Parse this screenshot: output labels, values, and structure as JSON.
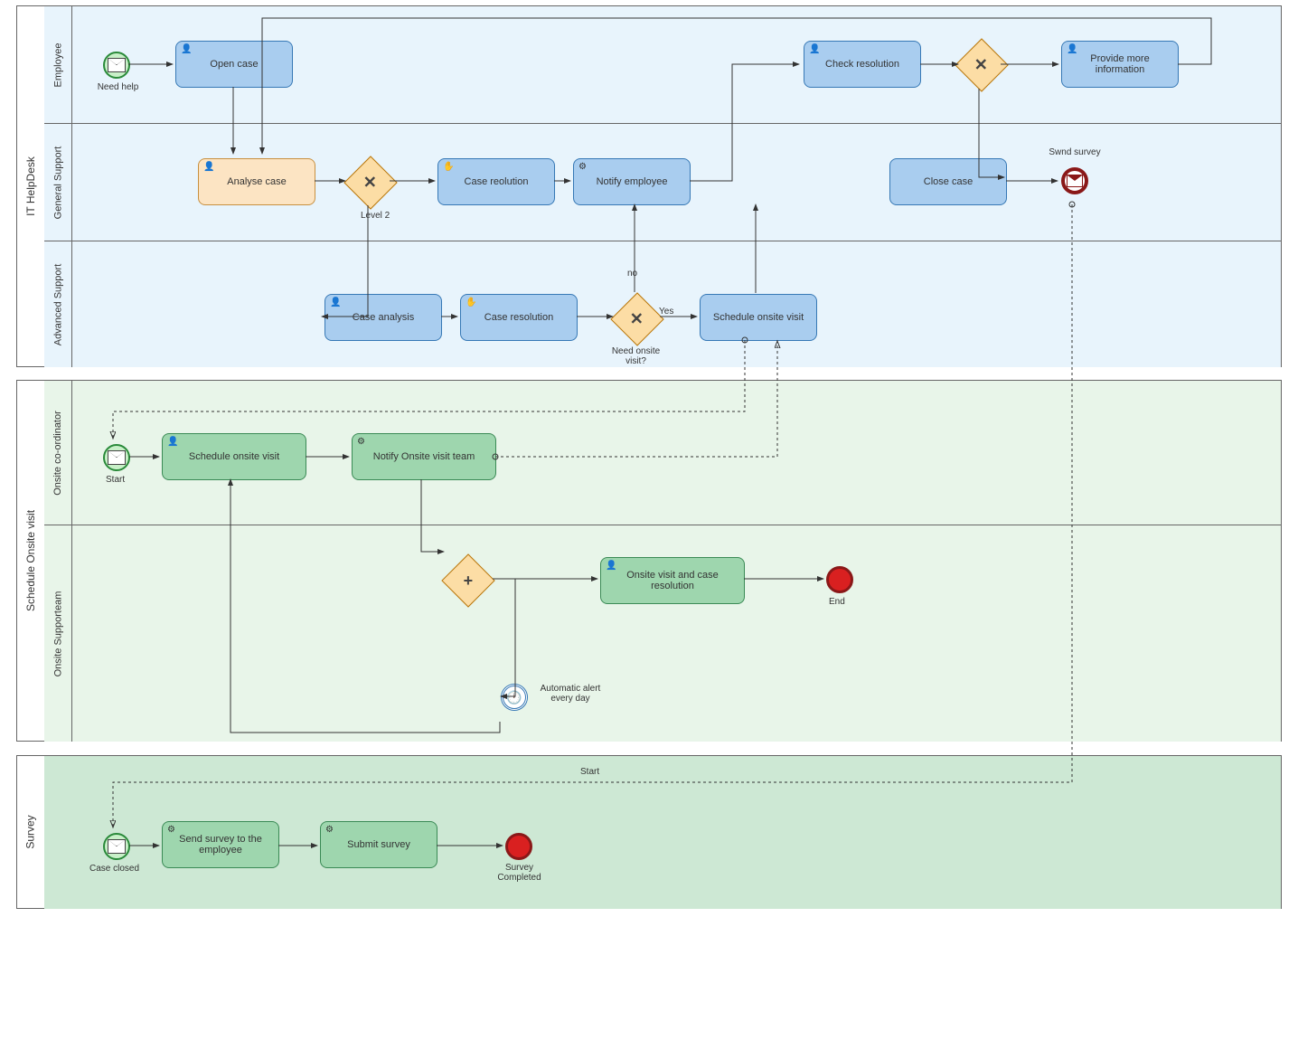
{
  "pools": {
    "helpdesk": {
      "title": "IT HelpDesk",
      "lanes": [
        "Employee",
        "General Support",
        "Advanced Support"
      ]
    },
    "onsite": {
      "title": "Schedule Onsite visit",
      "lanes": [
        "Onsite co-ordinator",
        "Onsite Supporteam"
      ]
    },
    "survey": {
      "title": "Survey"
    }
  },
  "events": {
    "needHelp": "Need help",
    "sendSurvey": "Swnd survey",
    "start1": "Start",
    "end1": "End",
    "autoAlert": "Automatic alert every day",
    "caseClosed": "Case closed",
    "start2": "Start",
    "surveyCompleted": "Survey Completed"
  },
  "tasks": {
    "openCase": "Open case",
    "checkRes": "Check resolution",
    "provideInfo": "Provide more information",
    "analyse": "Analyse case",
    "caseRes1": "Case reolution",
    "notifyEmp": "Notify employee",
    "closeCase": "Close case",
    "caseAnalysis": "Case analysis",
    "caseRes2": "Case resolution",
    "schedVisit1": "Schedule onsite visit",
    "schedVisit2": "Schedule onsite visit",
    "notifyTeam": "Notify Onsite visit team",
    "onsiteRes": "Onsite visit and case resolution",
    "sendSurvey": "Send survey to the employee",
    "submitSurvey": "Submit survey"
  },
  "gateways": {
    "level2": "Level 2",
    "needOnsite": "Need onsite visit?",
    "yes": "Yes",
    "no": "no"
  }
}
